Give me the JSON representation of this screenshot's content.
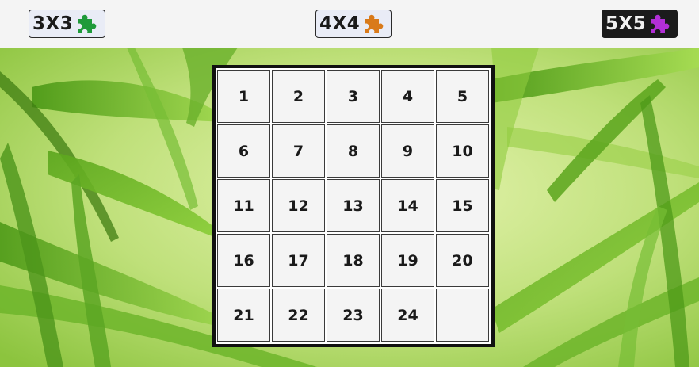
{
  "size_buttons": [
    {
      "label": "3X3",
      "icon": "puzzle-piece-icon",
      "icon_color": "#1f9a3a",
      "style": "light"
    },
    {
      "label": "4X4",
      "icon": "puzzle-piece-icon",
      "icon_color": "#d97a1a",
      "style": "light"
    },
    {
      "label": "5X5",
      "icon": "puzzle-piece-icon",
      "icon_color": "#b22fd6",
      "style": "dark",
      "selected": true
    }
  ],
  "board": {
    "grid_size": 5,
    "tiles": [
      "1",
      "2",
      "3",
      "4",
      "5",
      "6",
      "7",
      "8",
      "9",
      "10",
      "11",
      "12",
      "13",
      "14",
      "15",
      "16",
      "17",
      "18",
      "19",
      "20",
      "21",
      "22",
      "23",
      "24",
      ""
    ]
  },
  "background": {
    "description_colors": {
      "light": "#d6ec9a",
      "leaf": "#7cbf2a"
    }
  }
}
